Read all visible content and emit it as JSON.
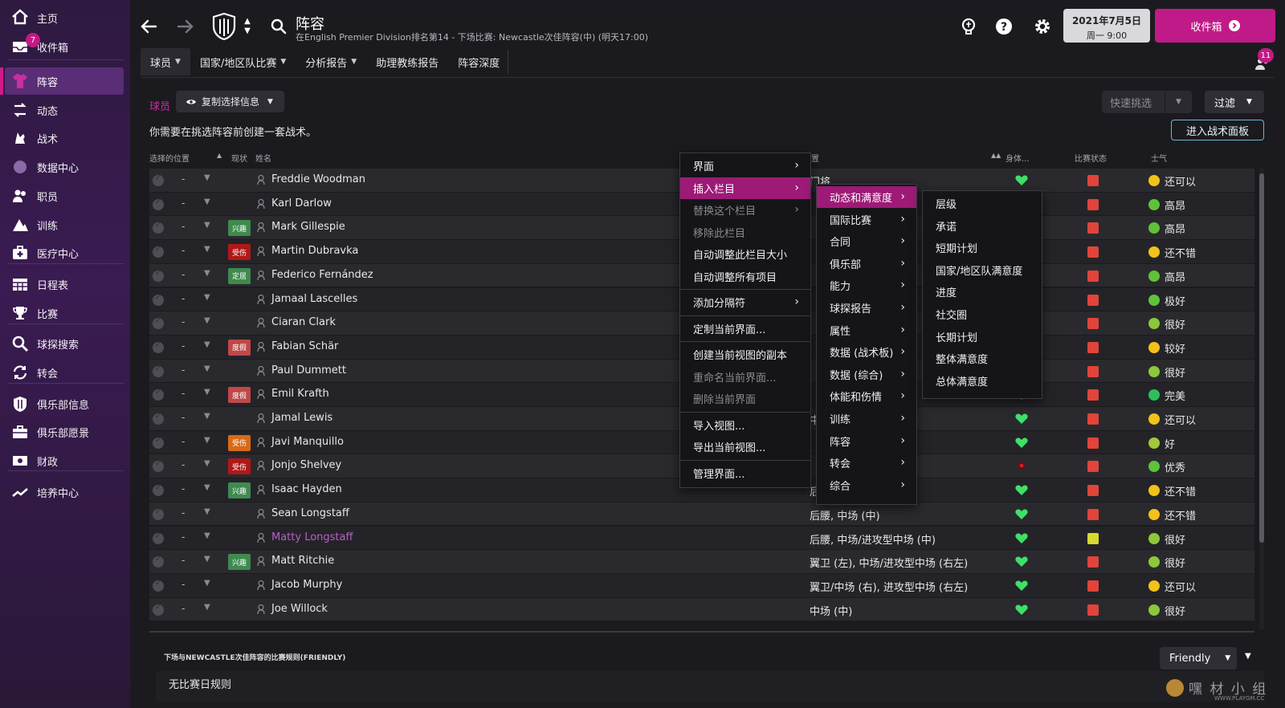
{
  "sidebar": {
    "items": [
      {
        "label": "主页",
        "icon": "home-icon"
      },
      {
        "label": "收件箱",
        "icon": "inbox-icon",
        "badge": "7"
      },
      {
        "label": "阵容",
        "icon": "shirt-icon",
        "active": true
      },
      {
        "label": "动态",
        "icon": "dynamics-icon"
      },
      {
        "label": "战术",
        "icon": "tactics-icon"
      },
      {
        "label": "数据中心",
        "icon": "data-hub-icon"
      },
      {
        "label": "职员",
        "icon": "staff-icon"
      },
      {
        "label": "训练",
        "icon": "training-icon"
      },
      {
        "label": "医疗中心",
        "icon": "medical-icon"
      },
      {
        "label": "日程表",
        "icon": "calendar-icon"
      },
      {
        "label": "比赛",
        "icon": "trophy-icon"
      },
      {
        "label": "球探搜索",
        "icon": "scouting-icon"
      },
      {
        "label": "转会",
        "icon": "transfers-icon"
      },
      {
        "label": "俱乐部信息",
        "icon": "club-info-icon"
      },
      {
        "label": "俱乐部愿景",
        "icon": "club-vision-icon"
      },
      {
        "label": "财政",
        "icon": "finances-icon"
      },
      {
        "label": "培养中心",
        "icon": "development-icon"
      }
    ]
  },
  "header": {
    "title": "阵容",
    "subtitle": "在English Premier Division排名第14 - 下场比赛: Newcastle次佳阵容(中) (明天17:00)",
    "date_line1": "2021年7月5日",
    "date_line2": "周一 9:00",
    "inbox_label": "收件箱",
    "notification_count": "11"
  },
  "subnav": [
    {
      "label": "球员",
      "has_dropdown": true
    },
    {
      "label": "国家/地区队比赛",
      "has_dropdown": true
    },
    {
      "label": "分析报告",
      "has_dropdown": true
    },
    {
      "label": "助理教练报告",
      "has_dropdown": false
    },
    {
      "label": "阵容深度",
      "has_dropdown": false
    }
  ],
  "toolbar": {
    "section_label": "球员",
    "copy_button": "复制选择信息",
    "note": "你需要在挑选阵容前创建一套战术。",
    "quick_pick": "快速挑选",
    "filter": "过滤",
    "tactics_button": "进入战术面板"
  },
  "columns": {
    "selected_pos": "选择的位置",
    "status": "现状",
    "name": "姓名",
    "position": "位置",
    "fitness": "身体...",
    "match_state": "比赛状态",
    "morale": "士气"
  },
  "players": [
    {
      "name": "Freddie Woodman",
      "status": "",
      "pos": "门将",
      "morale": "还可以"
    },
    {
      "name": "Karl Darlow",
      "status": "",
      "pos": "",
      "morale": "高昂"
    },
    {
      "name": "Mark Gillespie",
      "status": "兴趣",
      "pos": "",
      "morale": "高昂"
    },
    {
      "name": "Martin Dubravka",
      "status": "受伤",
      "pos": "",
      "morale": "还不错"
    },
    {
      "name": "Federico Fernández",
      "status": "定居",
      "pos": "",
      "morale": "高昂"
    },
    {
      "name": "Jamaal Lascelles",
      "status": "",
      "pos": "",
      "morale": "极好"
    },
    {
      "name": "Ciaran Clark",
      "status": "",
      "pos": "",
      "morale": "很好"
    },
    {
      "name": "Fabian Schär",
      "status": "度假",
      "pos": "",
      "morale": "较好"
    },
    {
      "name": "Paul Dummett",
      "status": "",
      "pos": "",
      "morale": "很好"
    },
    {
      "name": "Emil Krafth",
      "status": "度假",
      "pos": "",
      "morale": "完美"
    },
    {
      "name": "Jamal Lewis",
      "status": "",
      "pos": "中场 (左)",
      "morale": "还可以"
    },
    {
      "name": "Javi Manquillo",
      "status": "受伤",
      "pos": "",
      "morale": "好"
    },
    {
      "name": "Jonjo Shelvey",
      "status": "受伤",
      "pos": "",
      "morale": "优秀"
    },
    {
      "name": "Isaac Hayden",
      "status": "兴趣",
      "pos": "后",
      "morale": "还不错"
    },
    {
      "name": "Sean Longstaff",
      "status": "",
      "pos": "后腰, 中场 (中)",
      "morale": "还不错"
    },
    {
      "name": "Matty Longstaff",
      "status": "",
      "pos": "后腰, 中场/进攻型中场 (中)",
      "morale": "很好"
    },
    {
      "name": "Matt Ritchie",
      "status": "兴趣",
      "pos": "翼卫 (左), 中场/进攻型中场 (右左)",
      "morale": "很好"
    },
    {
      "name": "Jacob Murphy",
      "status": "",
      "pos": "翼卫/中场 (右), 进攻型中场 (右左)",
      "morale": "还可以"
    },
    {
      "name": "Joe Willock",
      "status": "",
      "pos": "中场 (中)",
      "morale": "很好"
    }
  ],
  "menu1": [
    {
      "label": "界面",
      "sub": true
    },
    {
      "label": "插入栏目",
      "sub": true,
      "hl": true
    },
    {
      "label": "替换这个栏目",
      "sub": true,
      "dis": true
    },
    {
      "label": "移除此栏目",
      "dis": true
    },
    {
      "label": "自动调整此栏目大小"
    },
    {
      "label": "自动调整所有项目"
    },
    {
      "label": "添加分隔符",
      "sub": true
    },
    {
      "label": "定制当前界面..."
    },
    {
      "label": "创建当前视图的副本"
    },
    {
      "label": "重命名当前界面...",
      "dis": true
    },
    {
      "label": "删除当前界面",
      "dis": true
    },
    {
      "label": "导入视图..."
    },
    {
      "label": "导出当前视图..."
    },
    {
      "label": "管理界面..."
    }
  ],
  "menu2": [
    {
      "label": "动态和满意度",
      "hl": true
    },
    {
      "label": "国际比赛"
    },
    {
      "label": "合同"
    },
    {
      "label": "俱乐部"
    },
    {
      "label": "能力"
    },
    {
      "label": "球探报告"
    },
    {
      "label": "属性"
    },
    {
      "label": "数据 (战术板)"
    },
    {
      "label": "数据 (综合)"
    },
    {
      "label": "体能和伤情"
    },
    {
      "label": "训练"
    },
    {
      "label": "阵容"
    },
    {
      "label": "转会"
    },
    {
      "label": "综合"
    }
  ],
  "menu3": [
    {
      "label": "层级"
    },
    {
      "label": "承诺"
    },
    {
      "label": "短期计划"
    },
    {
      "label": "国家/地区队满意度"
    },
    {
      "label": "进度"
    },
    {
      "label": "社交圈"
    },
    {
      "label": "长期计划"
    },
    {
      "label": "整体满意度"
    },
    {
      "label": "总体满意度"
    }
  ],
  "bottom": {
    "rules_title": "下场与NEWCASTLE次佳阵容的比赛规则(FRIENDLY)",
    "rules_text": "无比赛日规则",
    "friendly": "Friendly",
    "watermark": "嘿 材 小 组",
    "watermark_url": "WWW.PLAYGM.CC"
  },
  "colors": {
    "accent": "#c01a88",
    "menu_highlight": "#9d1a77",
    "heart": "#3ee06a",
    "match_red": "#e0443a",
    "morale_yellow": "#f2c21a",
    "morale_green": "#5fc23a"
  }
}
